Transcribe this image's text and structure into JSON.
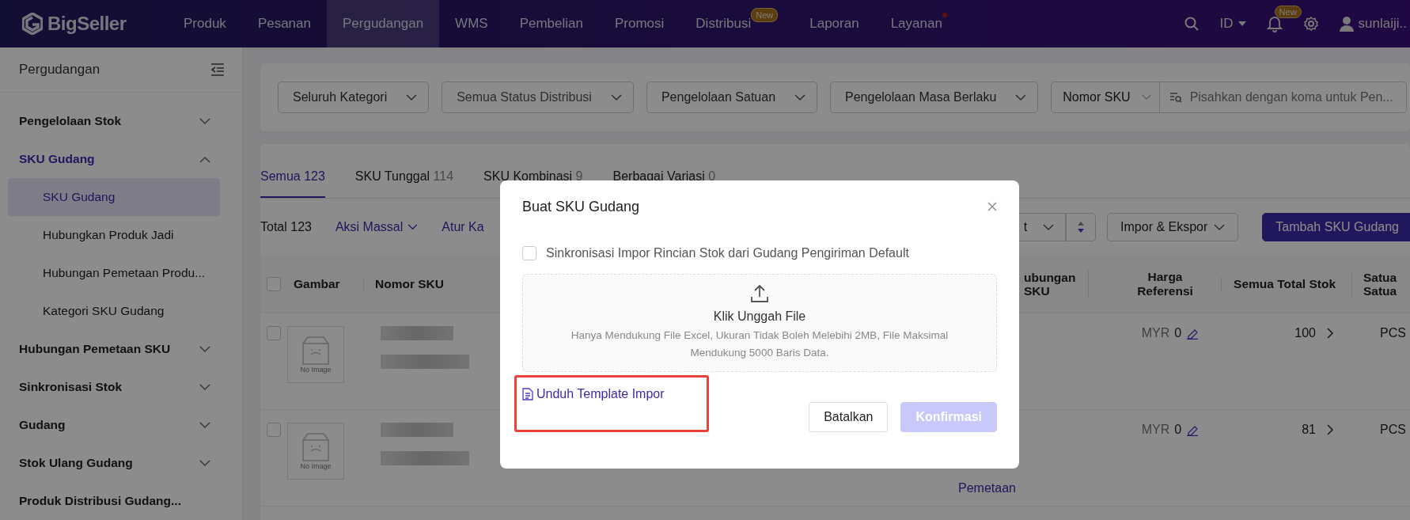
{
  "header": {
    "logo": "BigSeller",
    "nav": [
      {
        "label": "Produk",
        "selected": false,
        "dot": false
      },
      {
        "label": "Pesanan",
        "selected": false,
        "dot": false
      },
      {
        "label": "Pergudangan",
        "selected": true,
        "dot": false
      },
      {
        "label": "WMS",
        "selected": false,
        "dot": false
      },
      {
        "label": "Pembelian",
        "selected": false,
        "dot": false
      },
      {
        "label": "Promosi",
        "selected": false,
        "dot": false
      },
      {
        "label": "Distribusi",
        "selected": false,
        "dot": false,
        "badge": "New"
      },
      {
        "label": "Laporan",
        "selected": false,
        "dot": false
      },
      {
        "label": "Layanan",
        "selected": false,
        "dot": true
      }
    ],
    "language": "ID",
    "notification_badge": "New",
    "user": "sunlaiji.."
  },
  "sidebar": {
    "title": "Pergudangan",
    "groups": [
      {
        "kind": "group",
        "label": "Pengelolaan Stok",
        "expanded": false
      },
      {
        "kind": "group",
        "label": "SKU Gudang",
        "expanded": true,
        "children": [
          {
            "label": "SKU Gudang",
            "selected": true
          },
          {
            "label": "Hubungkan Produk Jadi",
            "selected": false
          },
          {
            "label": "Hubungan Pemetaan Produ...",
            "selected": false
          },
          {
            "label": "Kategori SKU Gudang",
            "selected": false
          }
        ]
      },
      {
        "kind": "group",
        "label": "Hubungan Pemetaan SKU",
        "expanded": false
      },
      {
        "kind": "group",
        "label": "Sinkronisasi Stok",
        "expanded": false
      },
      {
        "kind": "group",
        "label": "Gudang",
        "expanded": false
      },
      {
        "kind": "group",
        "label": "Stok Ulang Gudang",
        "expanded": false
      },
      {
        "kind": "link",
        "label": "Produk Distribusi Gudang..."
      }
    ]
  },
  "filters": [
    "Seluruh Kategori",
    "Semua Status Distribusi",
    "Pengelolaan Satuan",
    "Pengelolaan Masa Berlaku"
  ],
  "search": {
    "field": "Nomor SKU",
    "placeholder": "Pisahkan dengan koma untuk Pen..."
  },
  "tabs": [
    {
      "label": "Semua",
      "count": "123",
      "selected": true
    },
    {
      "label": "SKU Tunggal",
      "count": "114",
      "selected": false
    },
    {
      "label": "SKU Kombinasi",
      "count": "9",
      "selected": false
    },
    {
      "label": "Berbagai Variasi",
      "count": "0",
      "selected": false
    }
  ],
  "toolbar": {
    "total": "Total 123",
    "bulk_action": "Aksi Massal",
    "settings": "Atur Ka",
    "sort": "t",
    "import_export": "Impor & Ekspor",
    "add": "Tambah SKU Gudang"
  },
  "table": {
    "select_all": {
      "checked": false
    },
    "columns": [
      "Gambar",
      "Nomor SKU",
      "ubungan SKU",
      "Harga Referensi",
      "Semua Total Stok",
      "Satua Satua"
    ],
    "rows": [
      {
        "checked": false,
        "image": "No Image",
        "currency": "MYR",
        "price": "0",
        "stock": "100",
        "unit": "PCS"
      },
      {
        "checked": false,
        "image": "No Image",
        "currency": "MYR",
        "price": "0",
        "stock": "81",
        "unit": "PCS",
        "link": "Pemetaan"
      }
    ]
  },
  "modal": {
    "title": "Buat SKU Gudang",
    "sync": {
      "label": "Sinkronisasi Impor Rincian Stok dari Gudang Pengiriman Default",
      "checked": false
    },
    "upload": {
      "title": "Klik Unggah File",
      "hint": "Hanya Mendukung File Excel, Ukuran Tidak Boleh Melebihi 2MB, File Maksimal Mendukung 5000 Baris Data."
    },
    "template_link": "Unduh Template Impor",
    "highlighted": true,
    "buttons": [
      {
        "kind": "cancel",
        "label": "Batalkan",
        "disabled": false
      },
      {
        "kind": "primary",
        "label": "Konfirmasi",
        "disabled": true
      }
    ]
  }
}
